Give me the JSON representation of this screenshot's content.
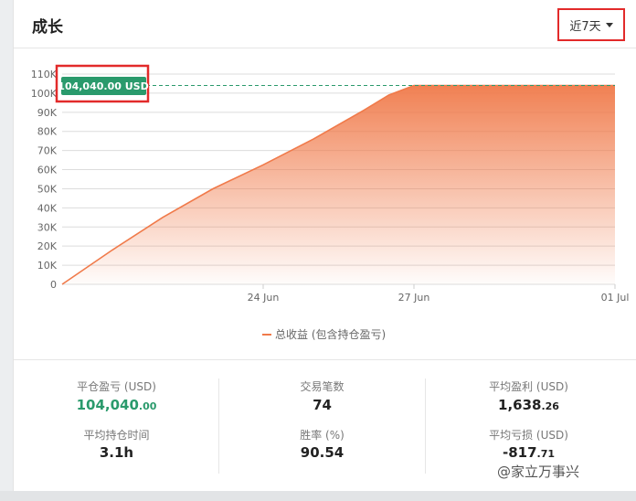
{
  "header": {
    "title": "成长",
    "range_label": "近7天"
  },
  "chart_data": {
    "type": "area",
    "x": [
      "20 Jun",
      "24 Jun",
      "25 Jun",
      "26 Jun",
      "27 Jun",
      "01 Jul"
    ],
    "x_ticks": [
      "24 Jun",
      "27 Jun",
      "01 Jul"
    ],
    "y_ticks": [
      "0",
      "10K",
      "20K",
      "30K",
      "40K",
      "50K",
      "60K",
      "70K",
      "80K",
      "90K",
      "100K",
      "110K"
    ],
    "ylim": [
      0,
      110000
    ],
    "series": [
      {
        "name": "总收益 (包含持仓盈亏)",
        "x": [
          "20 Jun",
          "21 Jun",
          "22 Jun",
          "23 Jun",
          "24 Jun",
          "25 Jun",
          "26 Jun",
          "26.5 Jun",
          "27 Jun",
          "01 Jul"
        ],
        "values": [
          0,
          18000,
          35000,
          50000,
          62500,
          76000,
          91000,
          99000,
          104040,
          104040
        ]
      }
    ],
    "current_value_label": "104,040.00 USD",
    "reference_line": 104040,
    "line_color": "#f07a4a",
    "label_color": "#2a9a6c",
    "grid": true
  },
  "legend": {
    "label": "总收益 (包含持仓盈亏)"
  },
  "stats": {
    "closed_pnl": {
      "label": "平仓盈亏 (USD)",
      "int": "104,040",
      "frac": ".00"
    },
    "avg_hold": {
      "label": "平均持仓时间",
      "value": "3.1h"
    },
    "trades": {
      "label": "交易笔数",
      "value": "74"
    },
    "win_rate": {
      "label": "胜率 (%)",
      "value": "90.54"
    },
    "avg_profit": {
      "label": "平均盈利 (USD)",
      "int": "1,638",
      "frac": ".26"
    },
    "avg_loss": {
      "label": "平均亏损 (USD)",
      "int": "-817",
      "frac": ".71"
    }
  },
  "watermark": "@家立万事兴"
}
